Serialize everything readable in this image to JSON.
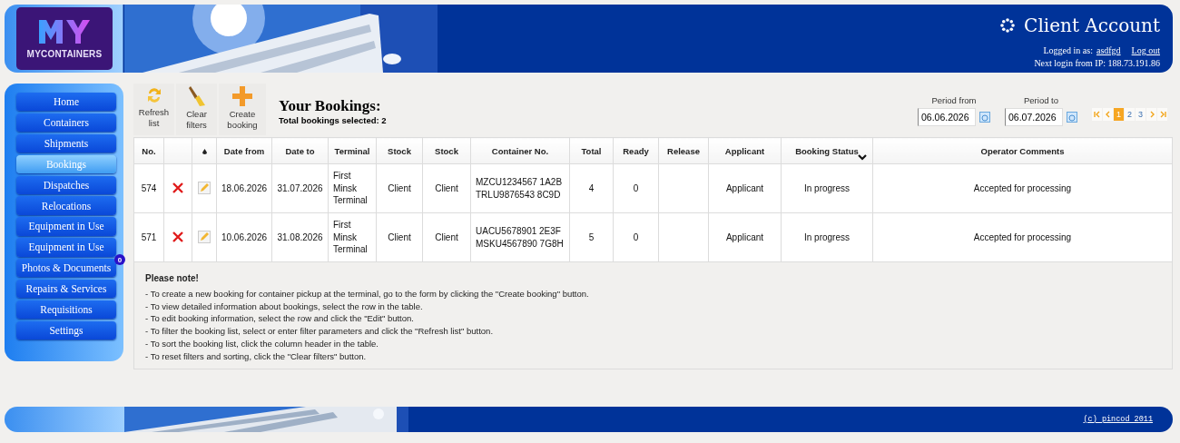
{
  "header": {
    "logo": "MYCONTAINERS",
    "title": "Client Account",
    "logged_in_label": "Logged in as:",
    "user": "asdfgd",
    "logout": "Log out",
    "next_login": "Next login from IP: 188.73.191.86"
  },
  "sidebar": {
    "items": [
      {
        "label": "Home",
        "selected": false
      },
      {
        "label": "Containers",
        "selected": false
      },
      {
        "label": "Shipments",
        "selected": false
      },
      {
        "label": "Bookings",
        "selected": true
      },
      {
        "label": "Dispatches",
        "selected": false
      },
      {
        "label": "Relocations",
        "selected": false
      },
      {
        "label": "Equipment in Use",
        "selected": false
      },
      {
        "label": "Equipment in Use",
        "selected": false
      },
      {
        "label": "Photos & Documents",
        "selected": false,
        "badge": "0"
      },
      {
        "label": "Repairs & Services",
        "selected": false
      },
      {
        "label": "Requisitions",
        "selected": false
      },
      {
        "label": "Settings",
        "selected": false
      }
    ]
  },
  "toolbar": [
    {
      "kind": "refresh",
      "label": "Refresh list"
    },
    {
      "kind": "clear",
      "label": "Clear filters"
    },
    {
      "kind": "create",
      "label": "Create booking"
    }
  ],
  "heading": {
    "title": "Your Bookings:",
    "subtitle": "Total bookings selected: 2"
  },
  "period": {
    "from_label": "Period from",
    "from": "06.06.2026",
    "to_label": "Period to",
    "to": "06.07.2026"
  },
  "pagination": [
    {
      "kind": "first"
    },
    {
      "kind": "prev"
    },
    {
      "kind": "page",
      "label": "1",
      "selected": true
    },
    {
      "kind": "page",
      "label": "2",
      "selected": false
    },
    {
      "kind": "page",
      "label": "3",
      "selected": false
    },
    {
      "kind": "next"
    },
    {
      "kind": "last"
    }
  ],
  "table": {
    "columns": [
      {
        "kind": "text",
        "label": "No."
      },
      {
        "kind": "delete"
      },
      {
        "kind": "edit"
      },
      {
        "kind": "text",
        "label": "Date from"
      },
      {
        "kind": "text",
        "label": "Date to"
      },
      {
        "kind": "text",
        "label": "Terminal"
      },
      {
        "kind": "text",
        "label": "Stock"
      },
      {
        "kind": "text",
        "label": "Stock"
      },
      {
        "kind": "text",
        "label": "Container No."
      },
      {
        "kind": "text",
        "label": "Total"
      },
      {
        "kind": "text",
        "label": "Ready"
      },
      {
        "kind": "text",
        "label": "Release"
      },
      {
        "kind": "text",
        "label": "Applicant"
      },
      {
        "kind": "sorted",
        "label": "Booking Status"
      },
      {
        "kind": "text",
        "label": "Operator Comments"
      }
    ],
    "rows": [
      {
        "no": "574",
        "date_from": "18.06.2026",
        "date_to": "31.07.2026",
        "terminal": "First Minsk Terminal",
        "stock_1": "Client",
        "stock_2": "Client",
        "containers": [
          "MZCU1234567 1A2B",
          "TRLU9876543 8C9D"
        ],
        "total": "4",
        "ready": "0",
        "applicant": "Applicant",
        "status": "In progress",
        "comments": "Accepted for processing"
      },
      {
        "no": "571",
        "date_from": "10.06.2026",
        "date_to": "31.08.2026",
        "terminal": "First Minsk Terminal",
        "stock_1": "Client",
        "stock_2": "Client",
        "containers": [
          "UACU5678901 2E3F",
          "MSKU4567890 7G8H"
        ],
        "total": "5",
        "ready": "0",
        "applicant": "Applicant",
        "status": "In progress",
        "comments": "Accepted for processing"
      }
    ]
  },
  "note": {
    "title": "Please note!",
    "lines": [
      "- To create a new booking for container pickup at the terminal, go to the form by clicking the \"Create booking\" button.",
      "- To view detailed information about bookings, select the row in the table.",
      "- To edit booking information, select the row and click the \"Edit\" button.",
      "- To filter the booking list, select or enter filter parameters and click the \"Refresh list\" button.",
      "- To sort the booking list, click the column header in the table.",
      "- To reset filters and sorting, click the \"Clear filters\" button."
    ]
  },
  "footer": {
    "copyright": "(c) pincod 2011"
  }
}
